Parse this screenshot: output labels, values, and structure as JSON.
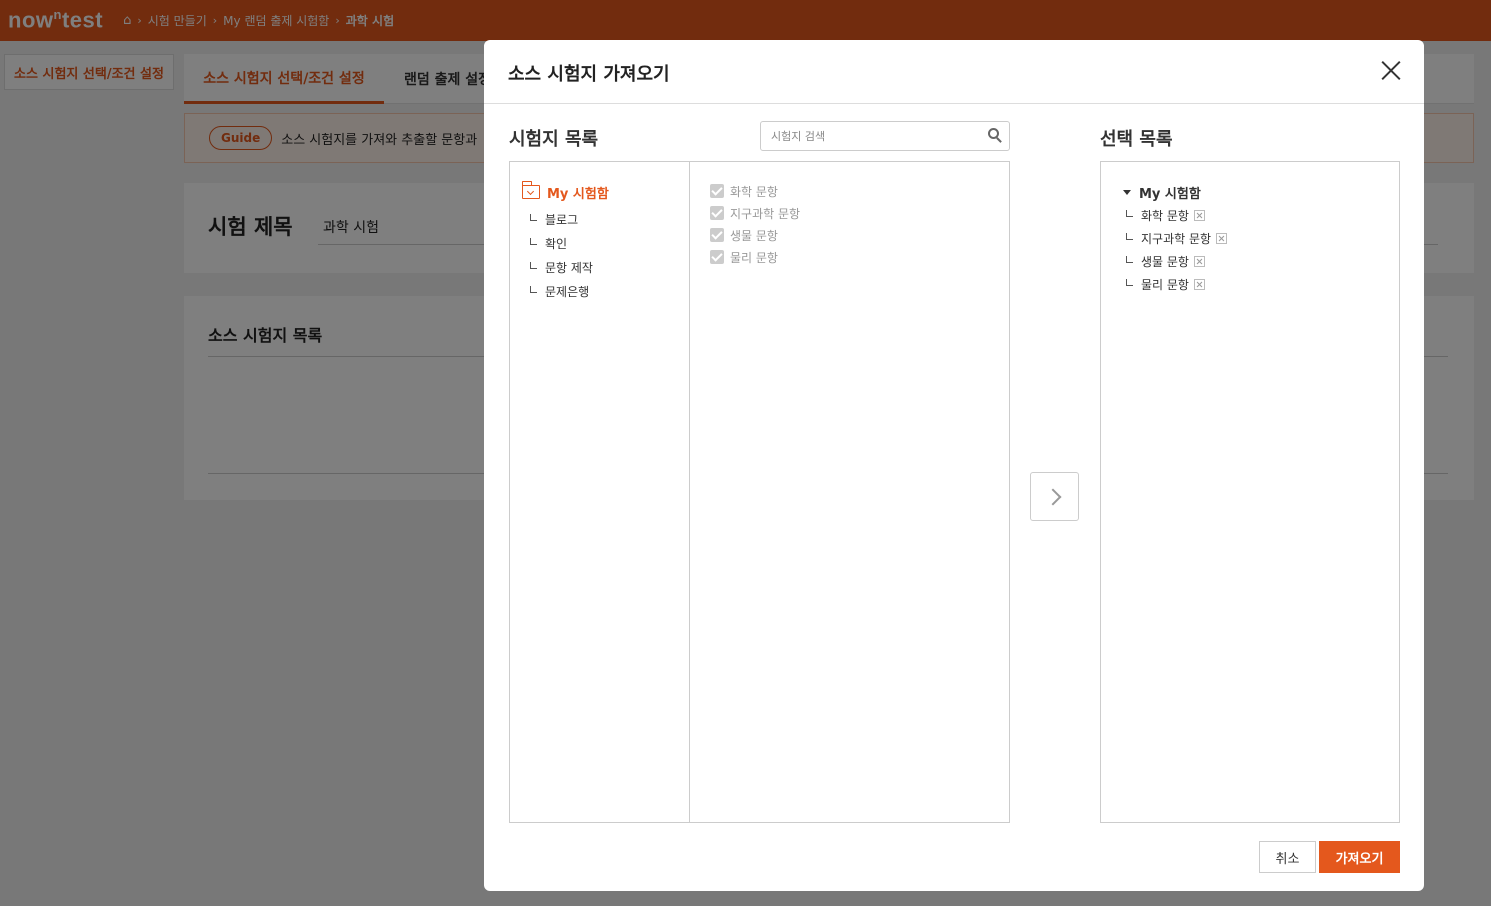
{
  "header": {
    "logo": "nowntest",
    "logo_sup": "n",
    "breadcrumbs": [
      "시험 만들기",
      "My 랜덤 출제 시험함",
      "과학 시험"
    ]
  },
  "page": {
    "side_tab": "소스 시험지 선택/조건 설정",
    "tabs": [
      "소스 시험지 선택/조건 설정",
      "랜덤 출제 설정"
    ],
    "guide_label": "Guide",
    "guide_text": "소스 시험지를 가져와 추출할 문항과",
    "exam_title_label": "시험 제목",
    "exam_title_value": "과학 시험",
    "source_list_title": "소스 시험지 목록"
  },
  "modal": {
    "title": "소스 시험지 가져오기",
    "left_title": "시험지 목록",
    "search_placeholder": "시험지 검색",
    "right_title": "선택 목록",
    "folder_root": "My 시험함",
    "folders": [
      "블로그",
      "확인",
      "문항 제작",
      "문제은행"
    ],
    "exams": [
      "화학 문항",
      "지구과학 문항",
      "생물 문항",
      "물리 문항"
    ],
    "selected_root": "My 시험함",
    "selected": [
      "화학 문항",
      "지구과학 문항",
      "생물 문항",
      "물리 문항"
    ],
    "cancel_label": "취소",
    "import_label": "가져오기"
  },
  "colors": {
    "accent": "#e4581d"
  }
}
